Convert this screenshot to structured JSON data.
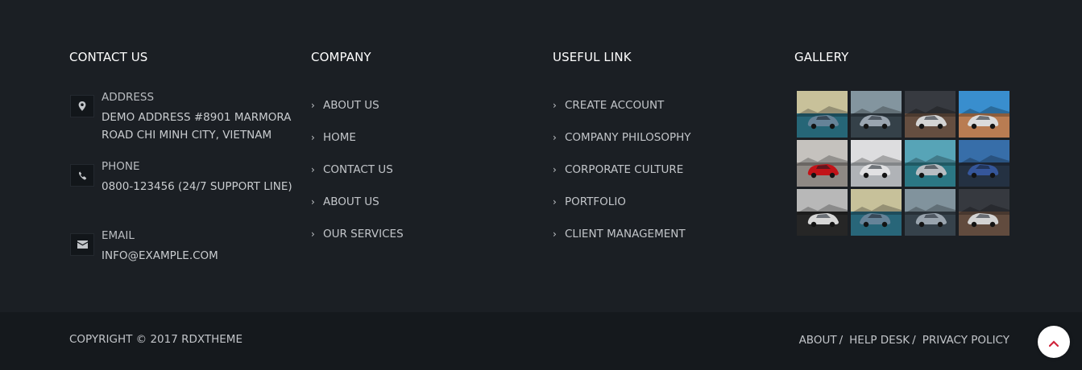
{
  "contact": {
    "title": "CONTACT US",
    "items": [
      {
        "icon": "map-pin-icon",
        "label": "ADDRESS",
        "value": "DEMO ADDRESS #8901 MARMORA ROAD CHI MINH CITY, VIETNAM"
      },
      {
        "icon": "phone-icon",
        "label": "PHONE",
        "value": "0800-123456 (24/7 SUPPORT LINE)"
      },
      {
        "icon": "envelope-icon",
        "label": "EMAIL",
        "value": "INFO@EXAMPLE.COM"
      }
    ]
  },
  "company": {
    "title": "COMPANY",
    "links": [
      "ABOUT US",
      "HOME",
      "CONTACT US",
      "ABOUT US",
      "OUR SERVICES"
    ]
  },
  "useful": {
    "title": "USEFUL LINK",
    "links": [
      "CREATE ACCOUNT",
      "COMPANY PHILOSOPHY",
      "CORPORATE CULTURE",
      "PORTFOLIO",
      "CLIENT MANAGEMENT"
    ]
  },
  "gallery": {
    "title": "GALLERY",
    "images": [
      {
        "name": "car-thumbnail-1",
        "sky": "#d9d2a8",
        "ground": "#2a6f82",
        "car": "#6f8fa5"
      },
      {
        "name": "car-thumbnail-2",
        "sky": "#8fa2ad",
        "ground": "#3a4750",
        "car": "#a8b4bf"
      },
      {
        "name": "car-thumbnail-3",
        "sky": "#3c3f46",
        "ground": "#6e5546",
        "car": "#e7e7e7"
      },
      {
        "name": "car-thumbnail-4",
        "sky": "#3e9be0",
        "ground": "#c9875a",
        "car": "#eeeeee"
      },
      {
        "name": "car-thumbnail-5",
        "sky": "#d6d3cf",
        "ground": "#9b9590",
        "car": "#d3151b"
      },
      {
        "name": "car-thumbnail-6",
        "sky": "#f0f0f2",
        "ground": "#bfc3c7",
        "car": "#f5f5f7"
      },
      {
        "name": "car-thumbnail-7",
        "sky": "#5fb2c7",
        "ground": "#2f8290",
        "car": "#c7ced3"
      },
      {
        "name": "car-thumbnail-8",
        "sky": "#3c78b8",
        "ground": "#283648",
        "car": "#3a5ea8"
      },
      {
        "name": "car-thumbnail-9",
        "sky": "#c8c8c8",
        "ground": "#2a2a2a",
        "car": "#eaeaea"
      },
      {
        "name": "car-thumbnail-10",
        "sky": "#d8d2a8",
        "ground": "#2c6f84",
        "car": "#6f8fa5"
      },
      {
        "name": "car-thumbnail-11",
        "sky": "#8da0ab",
        "ground": "#3b4852",
        "car": "#a6b2bd"
      },
      {
        "name": "car-thumbnail-12",
        "sky": "#3b3e45",
        "ground": "#6a5244",
        "car": "#e5e5e5"
      }
    ]
  },
  "bottom": {
    "copyright": "COPYRIGHT © 2017 RDXTHEME",
    "links": [
      "ABOUT",
      "HELP DESK",
      "PRIVACY POLICY"
    ],
    "separator": "/"
  },
  "colors": {
    "background": "#1b1f24",
    "bottom_bar": "#15191d",
    "accent": "#d0243a"
  }
}
